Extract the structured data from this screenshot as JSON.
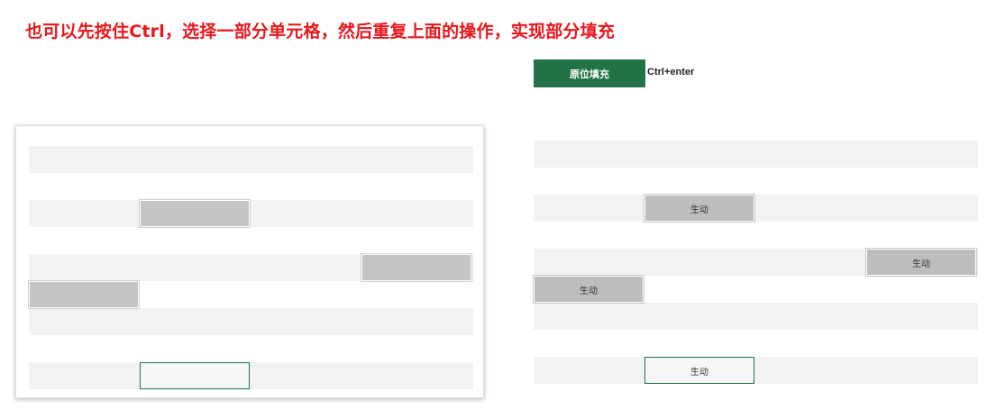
{
  "instruction": "也可以先按住Ctrl，选择一部分单元格，然后重复上面的操作，实现部分填充",
  "fill_button_label": "原位填充",
  "shortcut_label": "Ctrl+enter",
  "fill_value": "生动",
  "left_grid": {
    "shaded_rows": [
      0,
      2,
      4,
      6,
      8
    ],
    "selected_cells": [
      {
        "row": 2,
        "col": 1
      },
      {
        "row": 4,
        "col": 3
      },
      {
        "row": 5,
        "col": 0
      }
    ],
    "active_cell": {
      "row": 8,
      "col": 1
    }
  },
  "right_grid": {
    "shaded_rows": [
      0,
      2,
      4,
      6,
      8
    ],
    "filled_cells": [
      {
        "row": 2,
        "col": 1,
        "text": "生动"
      },
      {
        "row": 4,
        "col": 3,
        "text": "生动"
      },
      {
        "row": 5,
        "col": 0,
        "text": "生动"
      }
    ],
    "active_cell": {
      "row": 8,
      "col": 1,
      "text": "生动"
    }
  }
}
